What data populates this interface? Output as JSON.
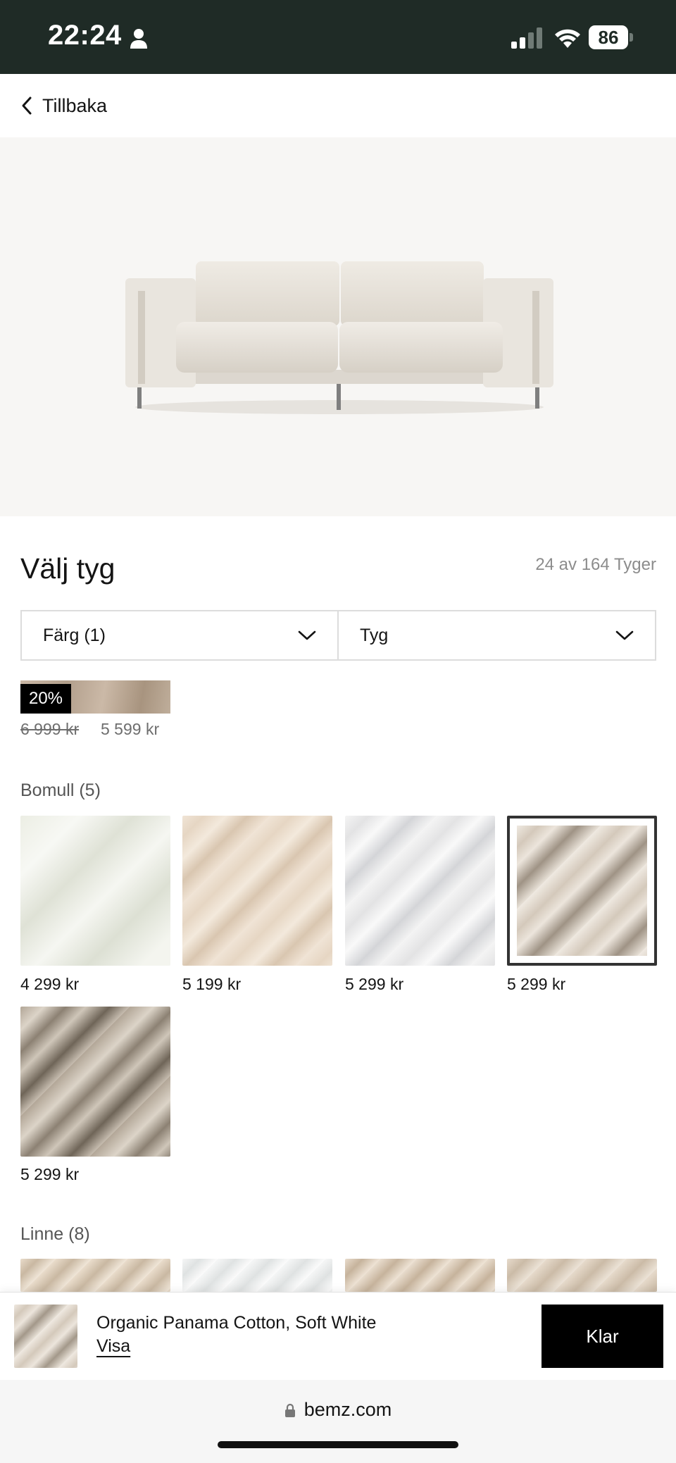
{
  "status_bar": {
    "time": "22:24",
    "battery": "86"
  },
  "nav": {
    "back_label": "Tillbaka"
  },
  "fabric_picker": {
    "title": "Välj tyg",
    "count": "24 av 164 Tyger",
    "filters": [
      {
        "label": "Färg (1)"
      },
      {
        "label": "Tyg"
      }
    ],
    "sale": {
      "badge": "20%",
      "old_price": "6 999 kr",
      "new_price": "5 599 kr"
    },
    "groups": [
      {
        "label": "Bomull (5)",
        "items": [
          {
            "price": "4 299 kr",
            "selected": false
          },
          {
            "price": "5 199 kr",
            "selected": false
          },
          {
            "price": "5 299 kr",
            "selected": false
          },
          {
            "price": "5 299 kr",
            "selected": true
          },
          {
            "price": "5 299 kr",
            "selected": false
          }
        ]
      },
      {
        "label": "Linne (8)"
      }
    ]
  },
  "selection_bar": {
    "name": "Organic Panama Cotton, Soft White",
    "view_label": "Visa",
    "done_label": "Klar"
  },
  "browser": {
    "url": "bemz.com"
  },
  "colors": {
    "status_bar_bg": "#1f2b26",
    "primary_button": "#000000",
    "hero_bg": "#f7f6f4"
  }
}
